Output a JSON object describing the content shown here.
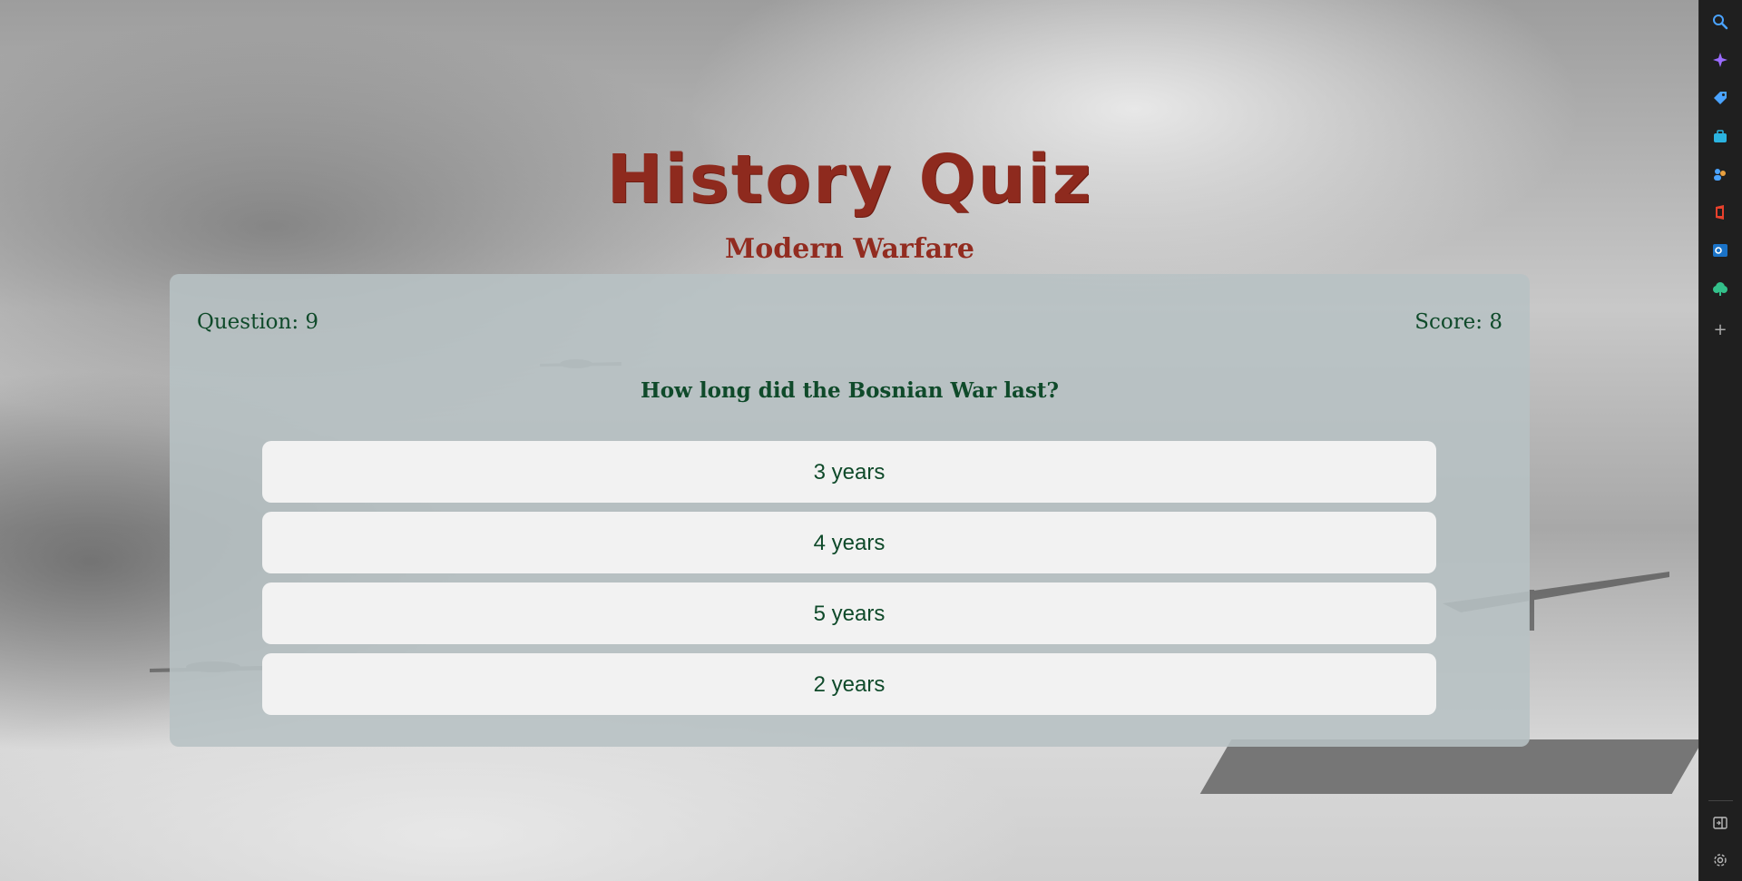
{
  "quiz": {
    "title": "History Quiz",
    "subtitle": "Modern Warfare",
    "question_label": "Question: 9",
    "score_label": "Score: 8",
    "question": "How long did the Bosnian War last?",
    "answers": [
      "3 years",
      "4 years",
      "5 years",
      "2 years"
    ]
  },
  "colors": {
    "title": "#8e2a1e",
    "text": "#0f4a2a",
    "card": "#b7c1c4",
    "answer_bg": "#f2f2f2",
    "sidebar": "#1f1f1f"
  },
  "sidebar": {
    "icons": [
      "search-icon",
      "sparkle-icon",
      "tag-icon",
      "briefcase-icon",
      "people-icon",
      "office-icon",
      "outlook-icon",
      "tree-icon",
      "add-icon",
      "split-view-icon",
      "settings-icon"
    ]
  }
}
